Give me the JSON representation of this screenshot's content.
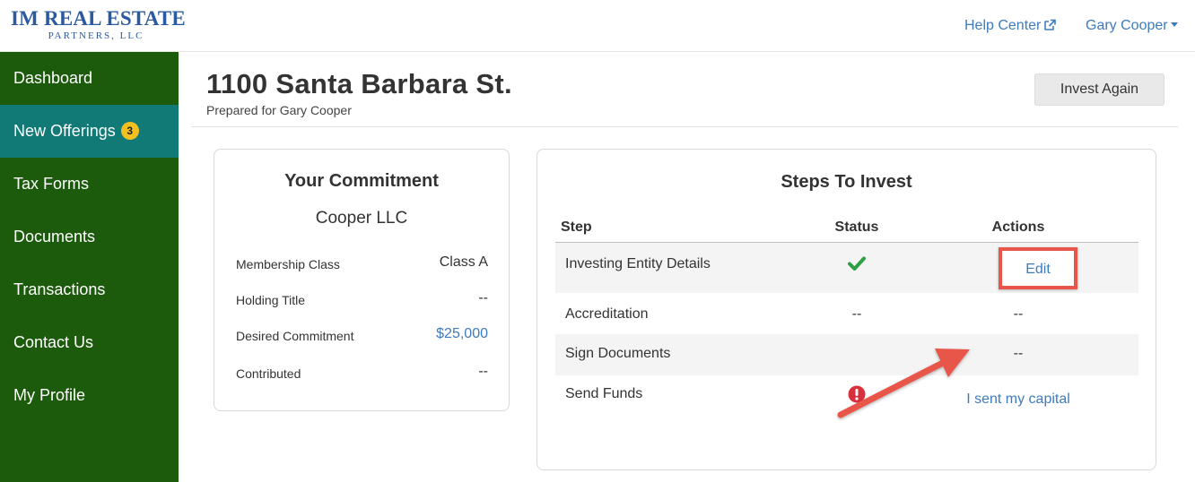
{
  "brand": {
    "name": "IM REAL ESTATE",
    "sub": "PARTNERS, LLC"
  },
  "topnav": {
    "help_label": "Help Center",
    "user_label": "Gary Cooper"
  },
  "sidebar": {
    "items": [
      {
        "label": "Dashboard"
      },
      {
        "label": "New Offerings",
        "badge": "3"
      },
      {
        "label": "Tax Forms"
      },
      {
        "label": "Documents"
      },
      {
        "label": "Transactions"
      },
      {
        "label": "Contact Us"
      },
      {
        "label": "My Profile"
      }
    ]
  },
  "header": {
    "title": "1100 Santa Barbara St.",
    "subtitle": "Prepared for Gary Cooper",
    "invest_again": "Invest Again"
  },
  "commitment": {
    "title": "Your Commitment",
    "entity": "Cooper LLC",
    "rows": [
      {
        "label": "Membership Class",
        "value": "Class A"
      },
      {
        "label": "Holding Title",
        "value": "--"
      },
      {
        "label": "Desired Commitment",
        "value": "$25,000"
      },
      {
        "label": "Contributed",
        "value": "--"
      }
    ]
  },
  "steps": {
    "title": "Steps To Invest",
    "headers": {
      "step": "Step",
      "status": "Status",
      "actions": "Actions"
    },
    "rows": [
      {
        "step": "Investing Entity Details",
        "status": "check-icon",
        "action": "Edit"
      },
      {
        "step": "Accreditation",
        "status": "--",
        "action": "--"
      },
      {
        "step": "Sign Documents",
        "status": "",
        "action": "--"
      },
      {
        "step": "Send Funds",
        "status": "alert-icon",
        "action": "I sent my capital"
      }
    ]
  },
  "colors": {
    "sidebar": "#1c5a0c",
    "sidebar_active": "#117a76",
    "link": "#3d7bbf",
    "highlight": "#e8554a",
    "success": "#2ea043",
    "danger": "#d9303d"
  }
}
